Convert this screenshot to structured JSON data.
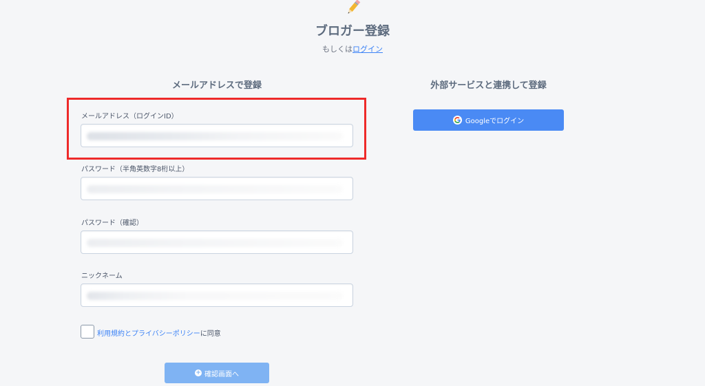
{
  "header": {
    "icon": "pencil-icon",
    "title": "ブロガー登録",
    "subtitle_prefix": "もしくは",
    "login_link": "ログイン"
  },
  "form": {
    "heading": "メールアドレスで登録",
    "fields": [
      {
        "label": "メールアドレス（ログインID）"
      },
      {
        "label": "パスワード（半角英数字8桁以上）"
      },
      {
        "label": "パスワード（確認）"
      },
      {
        "label": "ニックネーム"
      }
    ],
    "agree_link": "利用規約とプライバシーポリシー",
    "agree_suffix": "に同意",
    "submit_label": "確認画面へ"
  },
  "external": {
    "heading": "外部サービスと連携して登録",
    "google_label": "Googleでログイン"
  },
  "colors": {
    "accent": "#4a8af4",
    "submit_disabled": "#7fb3f3",
    "highlight": "#ee2a2a",
    "link": "#3b82f6"
  }
}
